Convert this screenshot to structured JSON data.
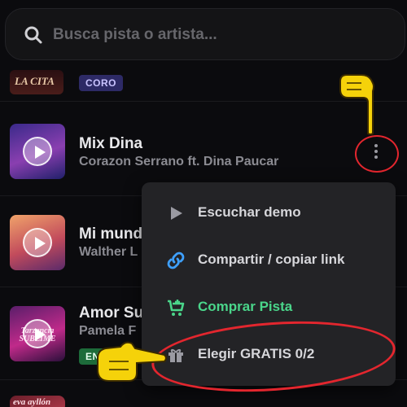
{
  "search": {
    "placeholder": "Busca pista o artista..."
  },
  "top_track": {
    "thumb_text": "LA CITA",
    "badge": "CORO"
  },
  "tracks": [
    {
      "title": "Mix Dina",
      "artist": "Corazon Serrano ft. Dina Paucar"
    },
    {
      "title": "Mi mund",
      "artist": "Walther L"
    },
    {
      "title": "Amor Su",
      "artist": "Pamela F",
      "badge": "EN"
    }
  ],
  "menu": {
    "items": [
      {
        "label": "Escuchar demo",
        "icon": "play-icon"
      },
      {
        "label": "Compartir / copiar link",
        "icon": "link-icon"
      },
      {
        "label": "Comprar Pista",
        "icon": "cart-icon"
      },
      {
        "label": "Elegir GRATIS 0/2",
        "icon": "gift-icon"
      }
    ]
  },
  "thumb_texts": {
    "amor": "Tarzancia SUBLIME",
    "bottom": "eva ayllón"
  },
  "colors": {
    "accent_green": "#4ad58a",
    "annotation_red": "#e3262e",
    "hand_yellow": "#f5d20a"
  }
}
